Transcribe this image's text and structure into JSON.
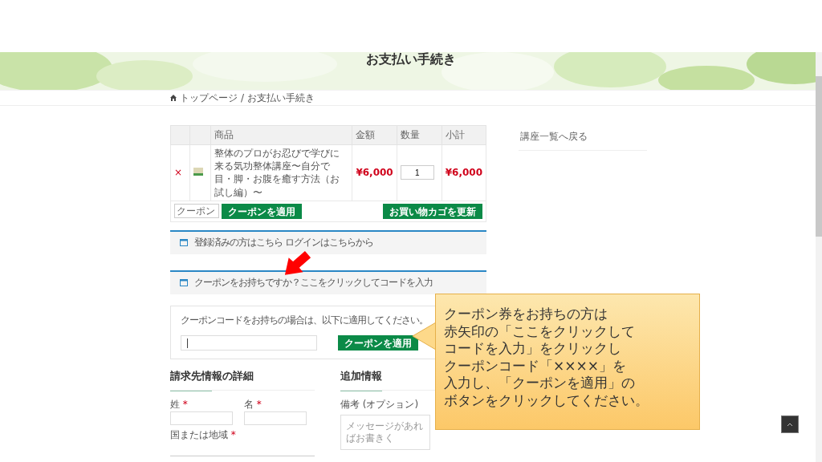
{
  "page_title": "お支払い手続き",
  "breadcrumb": [
    "トップページ",
    "お支払い手続き"
  ],
  "breadcrumb_separator": "/",
  "cart": {
    "columns": [
      "",
      "",
      "商品",
      "金額",
      "数量",
      "小計"
    ],
    "rows": [
      {
        "remove": "×",
        "product": "整体のプロがお忍びで学びに来る気功整体講座〜自分で目・脚・お腹を癒す方法（お試し編）〜",
        "price": "¥6,000",
        "quantity": "1",
        "subtotal": "¥6,000"
      }
    ],
    "coupon_placeholder": "クーポン",
    "apply_button": "クーポンを適用",
    "update_button": "お買い物カゴを更新"
  },
  "notices": [
    {
      "text": "登録済みの方はこちら ログインはこちらから"
    },
    {
      "text": "クーポンをお持ちですか？ここをクリックしてコードを入力"
    }
  ],
  "coupon_form": {
    "hint": "クーポンコードをお持ちの場合は、以下に適用してください。",
    "value": "|",
    "button": "クーポンを適用"
  },
  "billing": {
    "heading": "請求先情報の詳細",
    "required_mark": "*",
    "fields": [
      {
        "label": "姓",
        "required": true
      },
      {
        "label": "名",
        "required": true
      }
    ],
    "country_label": "国または地域",
    "country_required": true
  },
  "additional": {
    "heading": "追加情報",
    "notes_label": "備考 (オプション)",
    "notes_placeholder": "メッセージがあればお書きく"
  },
  "sidebar": {
    "link": "講座一覧へ戻る"
  },
  "callout": {
    "lines": [
      "クーポン券をお持ちの方は",
      "赤矢印の「ここをクリックして",
      "コードを入力」をクリックし",
      "クーポンコード「××××」を",
      "入力し、「クーポンを適用」の",
      "ボタンをクリックしてください。"
    ]
  }
}
